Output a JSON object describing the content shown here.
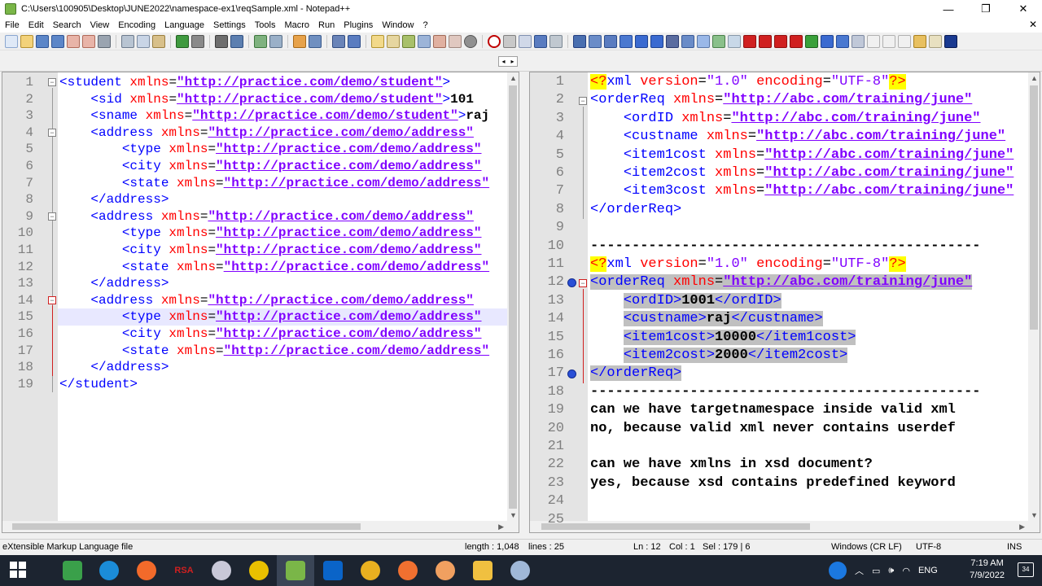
{
  "window": {
    "title": "C:\\Users\\100905\\Desktop\\JUNE2022\\namespace-ex1\\reqSample.xml - Notepad++",
    "minimize": "—",
    "restore": "❐",
    "close": "✕"
  },
  "menu": [
    "File",
    "Edit",
    "Search",
    "View",
    "Encoding",
    "Language",
    "Settings",
    "Tools",
    "Macro",
    "Run",
    "Plugins",
    "Window",
    "?"
  ],
  "menu_close": "✕",
  "tab_arrows": {
    "left": "◂",
    "right": "▸"
  },
  "left_editor": {
    "lines": [
      {
        "n": "1",
        "tokens": [
          [
            "tag",
            "<student "
          ],
          [
            "attr",
            "xmlns"
          ],
          [
            "eq",
            "="
          ],
          [
            "str",
            "\"http://practice.com/demo/student\""
          ],
          [
            "tag",
            ">"
          ]
        ]
      },
      {
        "n": "2",
        "tokens": [
          [
            "plain",
            "    "
          ],
          [
            "tag",
            "<sid "
          ],
          [
            "attr",
            "xmlns"
          ],
          [
            "eq",
            "="
          ],
          [
            "str",
            "\"http://practice.com/demo/student\""
          ],
          [
            "tag",
            ">"
          ],
          [
            "txt",
            "101"
          ]
        ]
      },
      {
        "n": "3",
        "tokens": [
          [
            "plain",
            "    "
          ],
          [
            "tag",
            "<sname "
          ],
          [
            "attr",
            "xmlns"
          ],
          [
            "eq",
            "="
          ],
          [
            "str",
            "\"http://practice.com/demo/student\""
          ],
          [
            "tag",
            ">"
          ],
          [
            "txt",
            "raj"
          ]
        ]
      },
      {
        "n": "4",
        "tokens": [
          [
            "plain",
            "    "
          ],
          [
            "tag",
            "<address "
          ],
          [
            "attr",
            "xmlns"
          ],
          [
            "eq",
            "="
          ],
          [
            "str",
            "\"http://practice.com/demo/address\""
          ]
        ]
      },
      {
        "n": "5",
        "tokens": [
          [
            "plain",
            "        "
          ],
          [
            "tag",
            "<type "
          ],
          [
            "attr",
            "xmlns"
          ],
          [
            "eq",
            "="
          ],
          [
            "str",
            "\"http://practice.com/demo/address\""
          ]
        ]
      },
      {
        "n": "6",
        "tokens": [
          [
            "plain",
            "        "
          ],
          [
            "tag",
            "<city "
          ],
          [
            "attr",
            "xmlns"
          ],
          [
            "eq",
            "="
          ],
          [
            "str",
            "\"http://practice.com/demo/address\""
          ]
        ]
      },
      {
        "n": "7",
        "tokens": [
          [
            "plain",
            "        "
          ],
          [
            "tag",
            "<state "
          ],
          [
            "attr",
            "xmlns"
          ],
          [
            "eq",
            "="
          ],
          [
            "str",
            "\"http://practice.com/demo/address\""
          ]
        ]
      },
      {
        "n": "8",
        "tokens": [
          [
            "plain",
            "    "
          ],
          [
            "tag",
            "</address>"
          ]
        ]
      },
      {
        "n": "9",
        "tokens": [
          [
            "plain",
            "    "
          ],
          [
            "tag",
            "<address "
          ],
          [
            "attr",
            "xmlns"
          ],
          [
            "eq",
            "="
          ],
          [
            "str",
            "\"http://practice.com/demo/address\""
          ]
        ]
      },
      {
        "n": "10",
        "tokens": [
          [
            "plain",
            "        "
          ],
          [
            "tag",
            "<type "
          ],
          [
            "attr",
            "xmlns"
          ],
          [
            "eq",
            "="
          ],
          [
            "str",
            "\"http://practice.com/demo/address\""
          ]
        ]
      },
      {
        "n": "11",
        "tokens": [
          [
            "plain",
            "        "
          ],
          [
            "tag",
            "<city "
          ],
          [
            "attr",
            "xmlns"
          ],
          [
            "eq",
            "="
          ],
          [
            "str",
            "\"http://practice.com/demo/address\""
          ]
        ]
      },
      {
        "n": "12",
        "tokens": [
          [
            "plain",
            "        "
          ],
          [
            "tag",
            "<state "
          ],
          [
            "attr",
            "xmlns"
          ],
          [
            "eq",
            "="
          ],
          [
            "str",
            "\"http://practice.com/demo/address\""
          ]
        ]
      },
      {
        "n": "13",
        "tokens": [
          [
            "plain",
            "    "
          ],
          [
            "tag",
            "</address>"
          ]
        ]
      },
      {
        "n": "14",
        "tokens": [
          [
            "plain",
            "    "
          ],
          [
            "tag",
            "<address "
          ],
          [
            "attr",
            "xmlns"
          ],
          [
            "eq",
            "="
          ],
          [
            "str",
            "\"http://practice.com/demo/address\""
          ]
        ]
      },
      {
        "n": "15",
        "tokens": [
          [
            "plain",
            "        "
          ],
          [
            "tag",
            "<type "
          ],
          [
            "attr",
            "xmlns"
          ],
          [
            "eq",
            "="
          ],
          [
            "str",
            "\"http://practice.com/demo/address\""
          ]
        ]
      },
      {
        "n": "16",
        "tokens": [
          [
            "plain",
            "        "
          ],
          [
            "tag",
            "<city "
          ],
          [
            "attr",
            "xmlns"
          ],
          [
            "eq",
            "="
          ],
          [
            "str",
            "\"http://practice.com/demo/address\""
          ]
        ]
      },
      {
        "n": "17",
        "tokens": [
          [
            "plain",
            "        "
          ],
          [
            "tag",
            "<state "
          ],
          [
            "attr",
            "xmlns"
          ],
          [
            "eq",
            "="
          ],
          [
            "str",
            "\"http://practice.com/demo/address\""
          ]
        ]
      },
      {
        "n": "18",
        "tokens": [
          [
            "plain",
            "    "
          ],
          [
            "tag",
            "</address>"
          ]
        ]
      },
      {
        "n": "19",
        "tokens": [
          [
            "tag",
            "</student>"
          ]
        ]
      }
    ]
  },
  "right_editor": {
    "lines": [
      {
        "n": "1",
        "tokens": [
          [
            "pi",
            "<?"
          ],
          [
            "tag",
            "xml "
          ],
          [
            "attr",
            "version"
          ],
          [
            "eq",
            "="
          ],
          [
            "str2",
            "\"1.0\""
          ],
          [
            "tag",
            " "
          ],
          [
            "attr",
            "encoding"
          ],
          [
            "eq",
            "="
          ],
          [
            "str2",
            "\"UTF-8\""
          ],
          [
            "pi",
            "?>"
          ]
        ]
      },
      {
        "n": "2",
        "tokens": [
          [
            "tag",
            "<orderReq "
          ],
          [
            "attr",
            "xmlns"
          ],
          [
            "eq",
            "="
          ],
          [
            "str",
            "\"http://abc.com/training/june\""
          ]
        ]
      },
      {
        "n": "3",
        "tokens": [
          [
            "plain",
            "    "
          ],
          [
            "tag",
            "<ordID "
          ],
          [
            "attr",
            "xmlns"
          ],
          [
            "eq",
            "="
          ],
          [
            "str",
            "\"http://abc.com/training/june\""
          ]
        ]
      },
      {
        "n": "4",
        "tokens": [
          [
            "plain",
            "    "
          ],
          [
            "tag",
            "<custname "
          ],
          [
            "attr",
            "xmlns"
          ],
          [
            "eq",
            "="
          ],
          [
            "str",
            "\"http://abc.com/training/june\""
          ]
        ]
      },
      {
        "n": "5",
        "tokens": [
          [
            "plain",
            "    "
          ],
          [
            "tag",
            "<item1cost "
          ],
          [
            "attr",
            "xmlns"
          ],
          [
            "eq",
            "="
          ],
          [
            "str",
            "\"http://abc.com/training/june\""
          ]
        ]
      },
      {
        "n": "6",
        "tokens": [
          [
            "plain",
            "    "
          ],
          [
            "tag",
            "<item2cost "
          ],
          [
            "attr",
            "xmlns"
          ],
          [
            "eq",
            "="
          ],
          [
            "str",
            "\"http://abc.com/training/june\""
          ]
        ]
      },
      {
        "n": "7",
        "tokens": [
          [
            "plain",
            "    "
          ],
          [
            "tag",
            "<item3cost "
          ],
          [
            "attr",
            "xmlns"
          ],
          [
            "eq",
            "="
          ],
          [
            "str",
            "\"http://abc.com/training/june\""
          ]
        ]
      },
      {
        "n": "8",
        "tokens": [
          [
            "tag",
            "</orderReq>"
          ]
        ]
      },
      {
        "n": "9",
        "tokens": []
      },
      {
        "n": "10",
        "tokens": [
          [
            "dash",
            "-----------------------------------------------"
          ]
        ]
      },
      {
        "n": "11",
        "tokens": [
          [
            "pi",
            "<?"
          ],
          [
            "tag",
            "xml "
          ],
          [
            "attr",
            "version"
          ],
          [
            "eq",
            "="
          ],
          [
            "str2",
            "\"1.0\""
          ],
          [
            "tag",
            " "
          ],
          [
            "attr",
            "encoding"
          ],
          [
            "eq",
            "="
          ],
          [
            "str2",
            "\"UTF-8\""
          ],
          [
            "pi",
            "?>"
          ]
        ]
      },
      {
        "n": "12",
        "tokens": [
          [
            "tag",
            "<orderReq "
          ],
          [
            "attr",
            "xmlns"
          ],
          [
            "eq",
            "="
          ],
          [
            "str",
            "\"http://abc.com/training/june\""
          ]
        ]
      },
      {
        "n": "13",
        "tokens": [
          [
            "plain",
            "    "
          ],
          [
            "tag",
            "<ordID>"
          ],
          [
            "txt",
            "1001"
          ],
          [
            "tag",
            "</ordID>"
          ]
        ]
      },
      {
        "n": "14",
        "tokens": [
          [
            "plain",
            "    "
          ],
          [
            "tag",
            "<custname>"
          ],
          [
            "txt",
            "raj"
          ],
          [
            "tag",
            "</custname>"
          ]
        ]
      },
      {
        "n": "15",
        "tokens": [
          [
            "plain",
            "    "
          ],
          [
            "tag",
            "<item1cost>"
          ],
          [
            "txt",
            "10000"
          ],
          [
            "tag",
            "</item1cost>"
          ]
        ]
      },
      {
        "n": "16",
        "tokens": [
          [
            "plain",
            "    "
          ],
          [
            "tag",
            "<item2cost>"
          ],
          [
            "txt",
            "2000"
          ],
          [
            "tag",
            "</item2cost>"
          ]
        ]
      },
      {
        "n": "17",
        "tokens": [
          [
            "tag",
            "</orderReq>"
          ]
        ]
      },
      {
        "n": "18",
        "tokens": [
          [
            "dash",
            "-----------------------------------------------"
          ]
        ]
      },
      {
        "n": "19",
        "tokens": [
          [
            "plain",
            "can we have targetnamespace inside valid xml"
          ]
        ]
      },
      {
        "n": "20",
        "tokens": [
          [
            "plain",
            "no, because valid xml never contains userdef"
          ]
        ]
      },
      {
        "n": "21",
        "tokens": []
      },
      {
        "n": "22",
        "tokens": [
          [
            "plain",
            "can we have xmlns in xsd document?"
          ]
        ]
      },
      {
        "n": "23",
        "tokens": [
          [
            "plain",
            "yes, because xsd contains predefined keyword"
          ]
        ]
      },
      {
        "n": "24",
        "tokens": []
      },
      {
        "n": "25",
        "tokens": []
      }
    ]
  },
  "status": {
    "file_type": "eXtensible Markup Language file",
    "length": "length : 1,048",
    "lines": "lines : 25",
    "ln": "Ln : 12",
    "col": "Col : 1",
    "sel": "Sel : 179 | 6",
    "eol": "Windows (CR LF)",
    "encoding": "UTF-8",
    "mode": "INS"
  },
  "taskbar": {
    "rsa_label": "RSA",
    "lang": "ENG",
    "time": "7:19 AM",
    "date": "7/9/2022",
    "notif_count": "34"
  },
  "colors": {
    "tag": "#0000ff",
    "attr": "#ff0000",
    "string": "#8000ff",
    "pi_bg": "#ffff00",
    "selection": "#c0c0c0",
    "taskbar": "#1c2430"
  }
}
